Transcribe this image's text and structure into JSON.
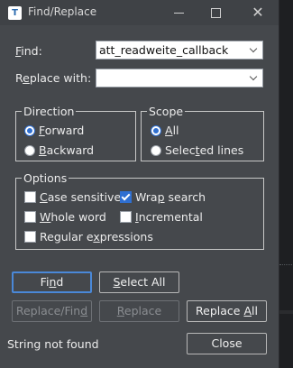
{
  "window": {
    "title": "Find/Replace",
    "app_icon_glyph": "T",
    "controls": {
      "minimize": "minimize-icon",
      "maximize": "maximize-icon",
      "close": "✕"
    }
  },
  "find": {
    "label_pre": "",
    "label_u": "F",
    "label_post": "ind:",
    "value": "att_readweite_callback"
  },
  "replace": {
    "label_pre": "R",
    "label_u": "e",
    "label_post": "place with:",
    "value": ""
  },
  "direction": {
    "legend": "Direction",
    "forward": {
      "pre": "",
      "u": "F",
      "post": "orward",
      "selected": true
    },
    "backward": {
      "pre": "",
      "u": "B",
      "post": "ackward",
      "selected": false
    }
  },
  "scope": {
    "legend": "Scope",
    "all": {
      "pre": "",
      "u": "A",
      "post": "ll",
      "selected": true
    },
    "selected_lines": {
      "pre": "Selec",
      "u": "t",
      "post": "ed lines",
      "selected": false
    }
  },
  "options": {
    "legend": "Options",
    "case_sensitive": {
      "pre": "",
      "u": "C",
      "post": "ase sensitive",
      "checked": false
    },
    "wrap_search": {
      "pre": "Wra",
      "u": "p",
      "post": " search",
      "checked": true
    },
    "whole_word": {
      "pre": "",
      "u": "W",
      "post": "hole word",
      "checked": false
    },
    "incremental": {
      "pre": "",
      "u": "I",
      "post": "ncremental",
      "checked": false
    },
    "regular_expressions": {
      "pre": "Regular e",
      "u": "x",
      "post": "pressions",
      "checked": false
    }
  },
  "buttons": {
    "find": {
      "pre": "Fi",
      "u": "n",
      "post": "d"
    },
    "select_all": {
      "pre": "",
      "u": "S",
      "post": "elect All"
    },
    "replace_find": {
      "pre": "Replace/Fin",
      "u": "d",
      "post": ""
    },
    "replace": {
      "pre": "",
      "u": "R",
      "post": "eplace"
    },
    "replace_all": {
      "pre": "Replace ",
      "u": "A",
      "post": "ll"
    },
    "close": "Close"
  },
  "status": "String not found",
  "colors": {
    "accent": "#2f6fd1",
    "dialog_bg": "#45484c",
    "default_button_border": "#4a88d8"
  }
}
